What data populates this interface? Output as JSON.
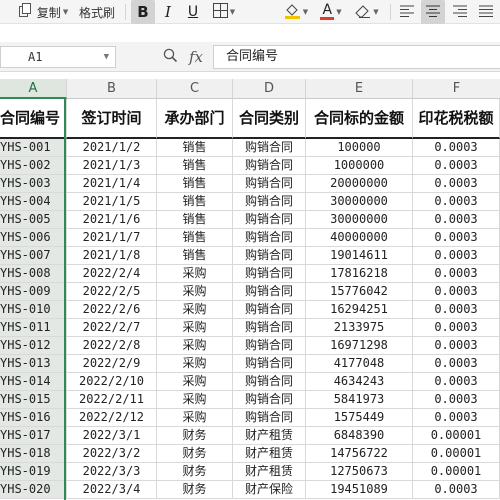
{
  "toolbar": {
    "copy_label": "复制",
    "format_painter_label": "格式刷",
    "bold_label": "B",
    "italic_label": "I",
    "underline_label": "U",
    "font_color_label": "A",
    "accent_color": "#e03b2f"
  },
  "formula_bar": {
    "name_box": "A1",
    "fx_label": "fx",
    "content": "合同编号"
  },
  "columns": [
    "A",
    "B",
    "C",
    "D",
    "E",
    "F"
  ],
  "sheet": {
    "headers": [
      "合同编号",
      "签订时间",
      "承办部门",
      "合同类别",
      "合同标的金额",
      "印花税税额"
    ],
    "rows": [
      [
        "YHS-001",
        "2021/1/2",
        "销售",
        "购销合同",
        "100000",
        "0.0003"
      ],
      [
        "YHS-002",
        "2021/1/3",
        "销售",
        "购销合同",
        "1000000",
        "0.0003"
      ],
      [
        "YHS-003",
        "2021/1/4",
        "销售",
        "购销合同",
        "20000000",
        "0.0003"
      ],
      [
        "YHS-004",
        "2021/1/5",
        "销售",
        "购销合同",
        "30000000",
        "0.0003"
      ],
      [
        "YHS-005",
        "2021/1/6",
        "销售",
        "购销合同",
        "30000000",
        "0.0003"
      ],
      [
        "YHS-006",
        "2021/1/7",
        "销售",
        "购销合同",
        "40000000",
        "0.0003"
      ],
      [
        "YHS-007",
        "2021/1/8",
        "销售",
        "购销合同",
        "19014611",
        "0.0003"
      ],
      [
        "YHS-008",
        "2022/2/4",
        "采购",
        "购销合同",
        "17816218",
        "0.0003"
      ],
      [
        "YHS-009",
        "2022/2/5",
        "采购",
        "购销合同",
        "15776042",
        "0.0003"
      ],
      [
        "YHS-010",
        "2022/2/6",
        "采购",
        "购销合同",
        "16294251",
        "0.0003"
      ],
      [
        "YHS-011",
        "2022/2/7",
        "采购",
        "购销合同",
        "2133975",
        "0.0003"
      ],
      [
        "YHS-012",
        "2022/2/8",
        "采购",
        "购销合同",
        "16971298",
        "0.0003"
      ],
      [
        "YHS-013",
        "2022/2/9",
        "采购",
        "购销合同",
        "4177048",
        "0.0003"
      ],
      [
        "YHS-014",
        "2022/2/10",
        "采购",
        "购销合同",
        "4634243",
        "0.0003"
      ],
      [
        "YHS-015",
        "2022/2/11",
        "采购",
        "购销合同",
        "5841973",
        "0.0003"
      ],
      [
        "YHS-016",
        "2022/2/12",
        "采购",
        "购销合同",
        "1575449",
        "0.0003"
      ],
      [
        "YHS-017",
        "2022/3/1",
        "财务",
        "财产租赁",
        "6848390",
        "0.00001"
      ],
      [
        "YHS-018",
        "2022/3/2",
        "财务",
        "财产租赁",
        "14756722",
        "0.00001"
      ],
      [
        "YHS-019",
        "2022/3/3",
        "财务",
        "财产租赁",
        "12750673",
        "0.00001"
      ],
      [
        "YHS-020",
        "2022/3/4",
        "财务",
        "财产保险",
        "19451089",
        "0.0003"
      ]
    ]
  }
}
